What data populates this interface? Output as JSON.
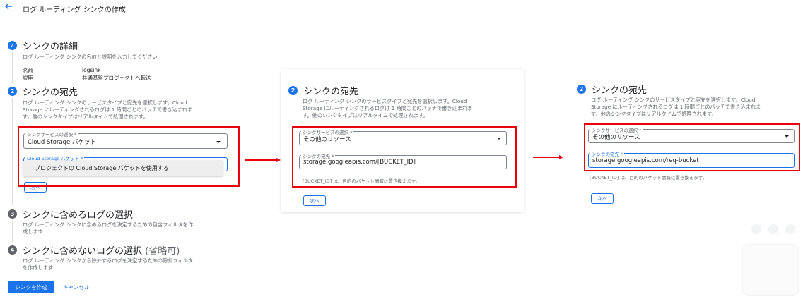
{
  "header": {
    "title": "ログ ルーティング シンクの作成"
  },
  "step1": {
    "title": "シンクの詳細",
    "desc": "ログ ルーティング シンクの名前と説明を入力してください",
    "name_label": "名前",
    "name_value": "logsink",
    "description_label": "説明",
    "description_value": "共通基盤プロジェクトへ転送"
  },
  "destination": {
    "number": "2",
    "title": "シンクの宛先",
    "desc_lines": [
      "ログ ルーティング シンクのサービスタイプと宛先を選択します。Cloud",
      "Storage にルーティングされるログは 1 時間ごとのバッチで書き込まれま",
      "す。他のシンクタイプはリアルタイムで処理されます。"
    ]
  },
  "panel1": {
    "service_label": "シンクサービスの選択 *",
    "service_value": "Cloud Storage バケット",
    "bucket_label": "Cloud Storage バケット *",
    "dropdown_option": "プロジェクトの Cloud Storage バケットを使用する",
    "next_label": "次へ"
  },
  "step3": {
    "number": "3",
    "title": "シンクに含めるログの選択",
    "desc_lines": [
      "ログ ルーティング シンクに含めるログを決定するための包含フィルタを作",
      "成します"
    ]
  },
  "step4": {
    "number": "4",
    "title": "シンクに含めないログの選択",
    "optional": "(省略可)",
    "desc_lines": [
      "ログ ルーティング シンクから除外するログを決定するための除外フィルタ",
      "を作成します"
    ]
  },
  "actions": {
    "create_label": "シンクを作成",
    "cancel_label": "キャンセル"
  },
  "panel2": {
    "service_label": "シンクサービスの選択 *",
    "service_value": "その他のリソース",
    "dest_label": "シンクの宛先 *",
    "dest_value": "storage.googleapis.com/[BUCKET_ID]",
    "hint": "[BUCKET_ID] は、目的のバケット情報に置き換えます。",
    "next_label": "次へ"
  },
  "panel3": {
    "service_label": "シンクサービスの選択 *",
    "service_value": "その他のリソース",
    "dest_label": "シンクの宛先 *",
    "dest_value": "storage.googleapis.com/req-bucket",
    "hint": "[BUCKET_ID] は、目的のバケット情報に置き換えます。",
    "next_label": "次へ"
  },
  "colors": {
    "accent": "#1a73e8",
    "highlight": "#e8000b"
  }
}
